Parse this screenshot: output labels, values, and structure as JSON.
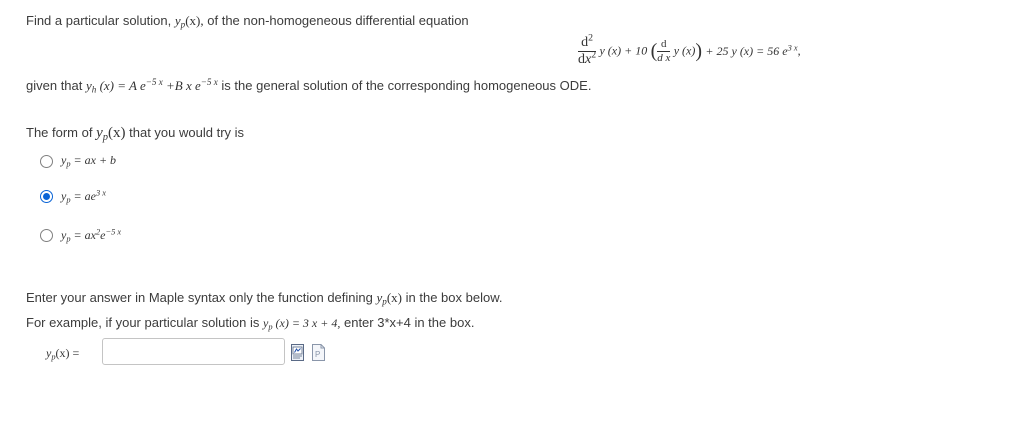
{
  "question": {
    "intro": "Find a particular solution,",
    "intro_var": "y",
    "intro_sub": "p",
    "intro_arg": "(x),",
    "intro_rest": "of the non-homogeneous differential equation",
    "equation": {
      "d2": "d",
      "d2_pow": "2",
      "dx": "d",
      "dx_var": "x",
      "dx_pow": "2",
      "term1": "y (x) + 10",
      "inner_num": "d",
      "inner_den": "d x",
      "inner_term": "y (x)",
      "term3": "+ 25 y (x) = 56 e",
      "rhs_exp": "3 x",
      "trailing": ","
    },
    "given_prefix": "given that",
    "given_formula": "y",
    "given_sub": "h",
    "given_rhs": "(x) = A e",
    "given_exp1": "−5 x",
    "given_mid": "+B x e",
    "given_exp2": "−5 x",
    "given_suffix": "is the general solution of the corresponding homogeneous ODE."
  },
  "form_prompt": {
    "prefix": "The form of",
    "var": "y",
    "sub": "p",
    "arg": "(x)",
    "suffix": "that you would try is"
  },
  "options": [
    {
      "lhs": "y",
      "sub": "p",
      "eq": " = ax + b",
      "sup": "",
      "tail": "",
      "sup2": "",
      "selected": false
    },
    {
      "lhs": "y",
      "sub": "p",
      "eq": " = ae",
      "sup": "3 x",
      "tail": "",
      "sup2": "",
      "selected": true
    },
    {
      "lhs": "y",
      "sub": "p",
      "eq": " = ax",
      "sup": "2",
      "tail": "e",
      "sup2": "−5 x",
      "selected": false
    }
  ],
  "instructions": {
    "line1_prefix": "Enter your answer in Maple syntax only the function defining",
    "line1_var": "y",
    "line1_sub": "p",
    "line1_arg": "(x)",
    "line1_suffix": "in the box below.",
    "line2_prefix": "For example, if your particular solution is",
    "line2_var": "y",
    "line2_sub": "p",
    "line2_eq": "(x) = 3 x + 4,",
    "line2_suffix": "enter 3*x+4 in the box."
  },
  "answer": {
    "label_var": "y",
    "label_sub": "p",
    "label_rest": "(x) =",
    "value": "",
    "placeholder": ""
  },
  "icons": [
    "equation-editor-icon",
    "preview-icon"
  ],
  "colors": {
    "radio_selected": "#0a64d6",
    "text": "#3c3c3c"
  }
}
